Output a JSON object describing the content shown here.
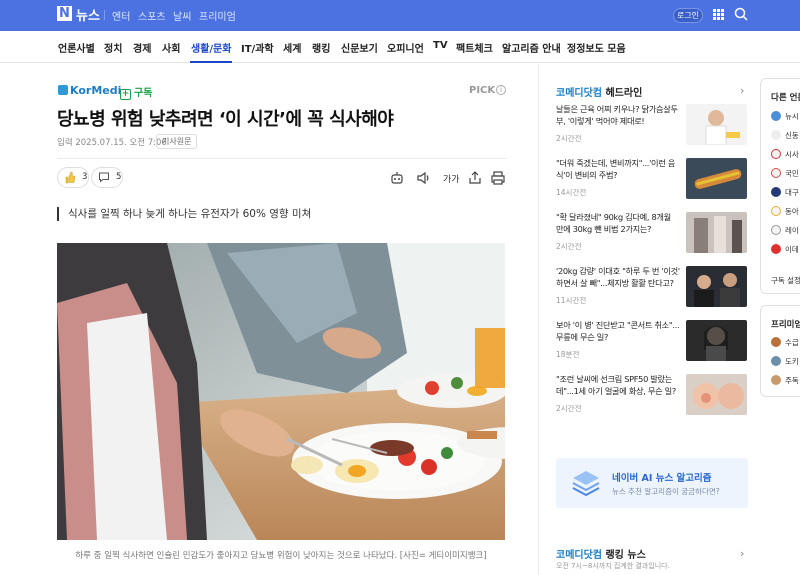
{
  "top_bar": {
    "logo_text": "뉴스",
    "nav": [
      "엔터",
      "스포츠",
      "날씨",
      "프리미엄"
    ],
    "login_label": "로그인"
  },
  "categories": [
    "언론사별",
    "정치",
    "경제",
    "사회",
    "생활/문화",
    "IT/과학",
    "세계",
    "랭킹",
    "신문보기",
    "오피니언",
    "TV",
    "팩트체크",
    "알고리즘 안내",
    "정정보도 모음"
  ],
  "active_category": "생활/문화",
  "article": {
    "press_name": "KorMedi",
    "subscribe_label": "구독",
    "pick_label": "PICK",
    "headline": "당뇨병 위험 낮추려면 ‘이 시간’에 꼭 식사해야",
    "date_label": "입력 2025.07.15. 오전 7:06",
    "original_link_label": "기사원문",
    "like_count": "3",
    "comment_count": "5",
    "font_size_label": "가가",
    "subtitle": "식사를 일찍 하나 늦게 하나는 유전자가 60% 영향 미쳐",
    "caption": "하루 중 일찍 식사하면 인슐린 민감도가 좋아지고 당뇨병 위험이 낮아지는 것으로 나타났다. [사진= 게티이미지뱅크]"
  },
  "headlines": {
    "brand": "코메디닷컴",
    "title": "헤드라인",
    "items": [
      {
        "text": "날들은 근육 어찌 키우나? 닭가슴살두부, '이렇게' 먹어야 제대로!",
        "time": "2시간전"
      },
      {
        "text": "\"더워 죽겠는데, 변비까지\"...'이런 음식'이 변비의 주범?",
        "time": "14시간전"
      },
      {
        "text": "\"확 달라졌네\" 90kg 김다예, 8개월 만에 30kg 뺀 비법 2가지는?",
        "time": "2시간전"
      },
      {
        "text": "'20kg 감량' 이대호 \"하루 두 번 '이것' 하면서 살 빼\"...체지방 활활 탄다고?",
        "time": "11시간전"
      },
      {
        "text": "보아 '이 병' 진단받고 \"콘서트 취소\"...무릎에 무슨 일?",
        "time": "18분전"
      },
      {
        "text": "\"조런 날씨에 선크림 SPF50 발랐는데\"...1세 아기 얼굴에 화상, 무슨 일?",
        "time": "2시간전"
      }
    ]
  },
  "ai_banner": {
    "title": "네이버 AI 뉴스 알고리즘",
    "subtitle": "뉴스 추천 알고리즘이 궁금하다면?"
  },
  "ranking": {
    "brand": "코메디닷컴",
    "title": "랭킹 뉴스",
    "subtitle": "오전 7시~8시까지 집계한 결과입니다."
  },
  "side_panel": {
    "title": "다른 언론",
    "items": [
      "뉴시",
      "신동",
      "시사",
      "국민",
      "대구",
      "동아",
      "레이",
      "이데"
    ],
    "settings_label": "구독 설정",
    "premium_title": "프리미엄",
    "premium_items": [
      "수급",
      "도키",
      "주독"
    ]
  },
  "colors": {
    "brand_blue": "#4b72e0",
    "active_blue": "#1a48c9",
    "subscribe_green": "#16a34a"
  }
}
